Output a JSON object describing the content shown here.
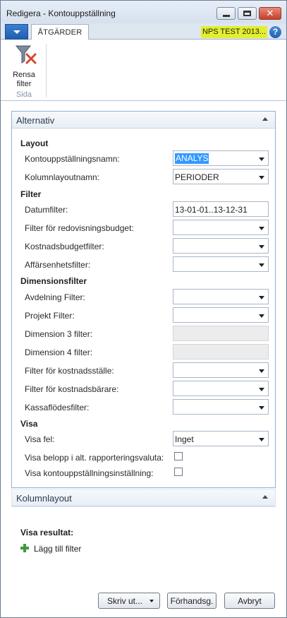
{
  "window": {
    "title": "Redigera - Kontouppställning"
  },
  "ribbon_tabs": {
    "actions_label": "ÅTGÄRDER",
    "company": "NPS TEST 2013...",
    "help_glyph": "?"
  },
  "ribbon": {
    "clear_filter_line1": "Rensa",
    "clear_filter_line2": "filter",
    "group_label": "Sida"
  },
  "options_tab": {
    "title": "Alternativ",
    "layout_heading": "Layout",
    "filter_heading": "Filter",
    "dimension_heading": "Dimensionsfilter",
    "show_heading": "Visa",
    "fields": {
      "account_schedule_name": {
        "label": "Kontouppställningsnamn:",
        "value": "ANALYS"
      },
      "column_layout_name": {
        "label": "Kolumnlayoutnamn:",
        "value": "PERIODER"
      },
      "date_filter": {
        "label": "Datumfilter:",
        "value": "13-01-01..13-12-31"
      },
      "budget_filter": {
        "label": "Filter för redovisningsbudget:",
        "value": ""
      },
      "cost_budget_filter": {
        "label": "Kostnadsbudgetfilter:",
        "value": ""
      },
      "business_unit_filter": {
        "label": "Affärsenhetsfilter:",
        "value": ""
      },
      "department_filter": {
        "label": "Avdelning Filter:",
        "value": ""
      },
      "project_filter": {
        "label": "Projekt Filter:",
        "value": ""
      },
      "dim3_filter": {
        "label": "Dimension 3 filter:",
        "value": ""
      },
      "dim4_filter": {
        "label": "Dimension 4 filter:",
        "value": ""
      },
      "cost_center_filter": {
        "label": "Filter för kostnadsställe:",
        "value": ""
      },
      "cost_object_filter": {
        "label": "Filter för kostnadsbärare:",
        "value": ""
      },
      "cash_flow_filter": {
        "label": "Kassaflödesfilter:",
        "value": ""
      },
      "show_error": {
        "label": "Visa fel:",
        "value": "Inget"
      },
      "show_alt_currency": {
        "label": "Visa belopp i alt. rapporteringsvaluta:",
        "checked": false
      },
      "show_setup": {
        "label": "Visa kontouppställningsinställning:",
        "checked": false
      }
    }
  },
  "column_layout_tab": {
    "title": "Kolumnlayout"
  },
  "results": {
    "heading": "Visa resultat:",
    "add_filter": "Lägg till filter"
  },
  "buttons": {
    "print": "Skriv ut...",
    "preview": "Förhandsg.",
    "cancel": "Avbryt"
  }
}
